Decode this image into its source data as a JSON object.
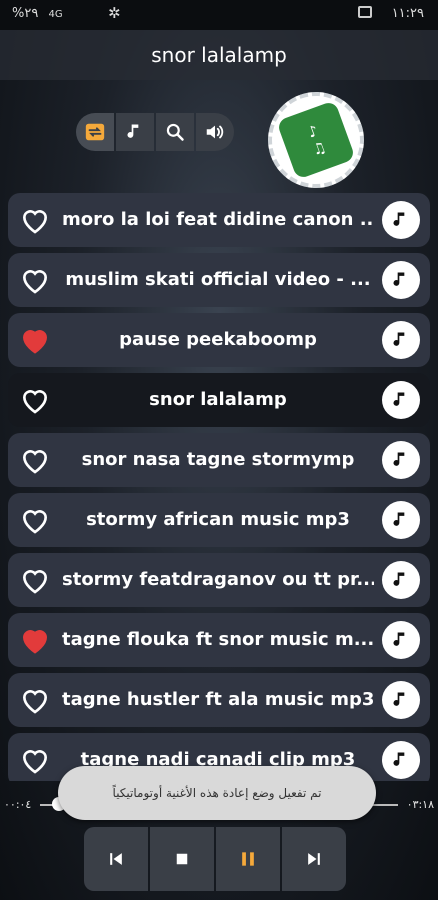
{
  "status_bar": {
    "time": "١١:٢٩",
    "battery": "%٢٩",
    "network": "4G"
  },
  "header": {
    "title": "snor lalalamp"
  },
  "colors": {
    "heart_active": "#e23b3b",
    "accent_orange": "#f5a93b",
    "row_bg": "#303542"
  },
  "songs": [
    {
      "title": "moro la loi feat didine canon ...",
      "liked": false
    },
    {
      "title": "muslim skati official video - ...",
      "liked": false
    },
    {
      "title": "pause peekaboomp",
      "liked": true
    },
    {
      "title": "snor lalalamp",
      "liked": false,
      "current": true
    },
    {
      "title": "snor nasa tagne stormymp",
      "liked": false
    },
    {
      "title": "stormy african music mp3",
      "liked": false
    },
    {
      "title": "stormy featdraganov ou tt pr...",
      "liked": false
    },
    {
      "title": "tagne flouka ft snor music m...",
      "liked": true
    },
    {
      "title": "tagne hustler ft ala music mp3",
      "liked": false
    },
    {
      "title": "tagne nadi canadi clip mp3",
      "liked": false
    }
  ],
  "player": {
    "elapsed": "٠٠:٠٤",
    "total": "٠٣:١٨",
    "progress": 0.02
  },
  "toast": {
    "message": "تم تفعيل وضع إعادة هذه الأغنية أوتوماتيكياً"
  },
  "icons": {
    "controls": [
      "repeat-icon",
      "music-note-icon",
      "search-icon",
      "volume-icon"
    ],
    "playback": [
      "skip-previous-icon",
      "stop-icon",
      "pause-icon",
      "skip-next-icon"
    ]
  }
}
